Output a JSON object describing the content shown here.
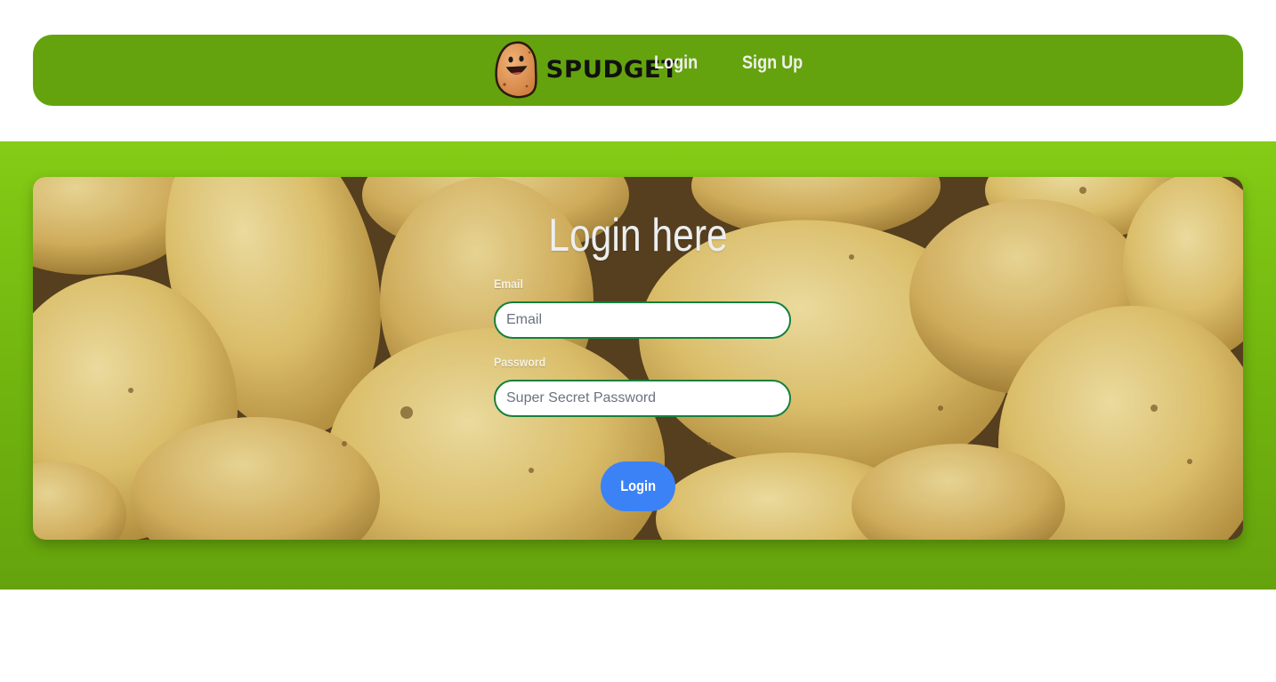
{
  "navbar": {
    "brand": "SPUDGET",
    "logo_icon": "potato-mascot-icon",
    "links": [
      {
        "label": "Login"
      },
      {
        "label": "Sign Up"
      }
    ],
    "background": "#64a30d"
  },
  "login_form": {
    "title": "Login here",
    "email": {
      "label": "Email",
      "placeholder": "Email",
      "value": ""
    },
    "password": {
      "label": "Password",
      "placeholder": "Super Secret Password",
      "value": ""
    },
    "submit_label": "Login",
    "submit_color": "#3b82f6",
    "background_image": "potatoes-photo"
  },
  "colors": {
    "section_gradient_top": "#84cc16",
    "section_gradient_bottom": "#65a30d",
    "input_border": "#15803d"
  }
}
